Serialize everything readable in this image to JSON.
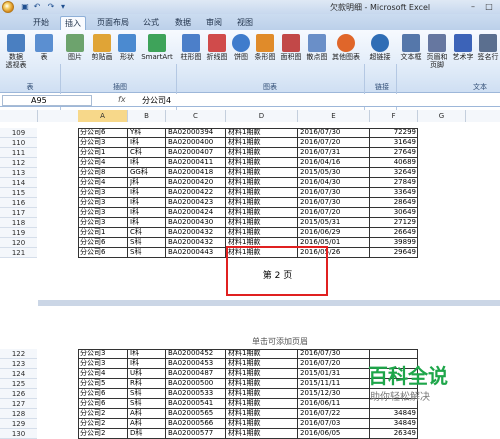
{
  "window": {
    "title": "欠款明细 - Microsoft Excel"
  },
  "tabs": [
    "开始",
    "插入",
    "页面布局",
    "公式",
    "数据",
    "审阅",
    "视图"
  ],
  "ribbon": {
    "items": [
      {
        "label": "数据\n透视表",
        "name": "pivot-table-button",
        "color": "#4a7fc1"
      },
      {
        "label": "表",
        "name": "table-button",
        "color": "#5b8fd1"
      },
      {
        "label": "图片",
        "name": "picture-button",
        "color": "#6da36d"
      },
      {
        "label": "剪贴画",
        "name": "clip-art-button",
        "color": "#e0a436"
      },
      {
        "label": "形状",
        "name": "shapes-button",
        "color": "#4b8ad0"
      },
      {
        "label": "SmartArt",
        "name": "smartart-button",
        "color": "#3ea35a"
      },
      {
        "label": "柱形图",
        "name": "column-chart-button",
        "color": "#4c7fc9"
      },
      {
        "label": "折线图",
        "name": "line-chart-button",
        "color": "#d04b4b"
      },
      {
        "label": "饼图",
        "name": "pie-chart-button",
        "color": "#3f7ccc"
      },
      {
        "label": "条形图",
        "name": "bar-chart-button",
        "color": "#e08b2a"
      },
      {
        "label": "面积图",
        "name": "area-chart-button",
        "color": "#c24848"
      },
      {
        "label": "散点图",
        "name": "scatter-chart-button",
        "color": "#6a8fc8"
      },
      {
        "label": "其他图表",
        "name": "other-charts-button",
        "color": "#e0662a"
      },
      {
        "label": "超链接",
        "name": "hyperlink-button",
        "color": "#2f6db5"
      },
      {
        "label": "文本框",
        "name": "text-box-button",
        "color": "#5577aa"
      },
      {
        "label": "页眉和\n页脚",
        "name": "header-footer-button",
        "color": "#6677a0"
      },
      {
        "label": "艺术字",
        "name": "wordart-button",
        "color": "#3c63b8"
      },
      {
        "label": "签名行",
        "name": "signature-line-button",
        "color": "#5b6f8f"
      }
    ],
    "groups": [
      "表",
      "插图",
      "图表",
      "链接",
      "文本"
    ]
  },
  "formula_bar": {
    "name_box": "A95",
    "fx": "fx",
    "value": "分公司4"
  },
  "columns": [
    "A",
    "B",
    "C",
    "D",
    "E",
    "F",
    "G"
  ],
  "selected_column": "A",
  "page1_rows": [
    {
      "row": "109",
      "a": "分公司6",
      "b": "Y科",
      "c": "BA02000394",
      "d": "材料1期款",
      "e": "2016/07/30",
      "f": "72299"
    },
    {
      "row": "110",
      "a": "分公司3",
      "b": "I科",
      "c": "BA02000400",
      "d": "材料1期款",
      "e": "2016/07/20",
      "f": "31649"
    },
    {
      "row": "111",
      "a": "分公司1",
      "b": "C科",
      "c": "BA02000407",
      "d": "材料1期款",
      "e": "2016/07/31",
      "f": "27649"
    },
    {
      "row": "112",
      "a": "分公司4",
      "b": "I科",
      "c": "BA02000411",
      "d": "材料1期款",
      "e": "2016/04/16",
      "f": "40689"
    },
    {
      "row": "113",
      "a": "分公司8",
      "b": "GG科",
      "c": "BA02000418",
      "d": "材料1期款",
      "e": "2015/05/30",
      "f": "32649"
    },
    {
      "row": "114",
      "a": "分公司4",
      "b": "J科",
      "c": "BA02000420",
      "d": "材料1期款",
      "e": "2016/04/30",
      "f": "27849"
    },
    {
      "row": "115",
      "a": "分公司3",
      "b": "I科",
      "c": "BA02000422",
      "d": "材料1期款",
      "e": "2016/07/30",
      "f": "33649"
    },
    {
      "row": "116",
      "a": "分公司3",
      "b": "I科",
      "c": "BA02000423",
      "d": "材料1期款",
      "e": "2016/07/30",
      "f": "28649"
    },
    {
      "row": "117",
      "a": "分公司3",
      "b": "I科",
      "c": "BA02000424",
      "d": "材料1期款",
      "e": "2016/07/20",
      "f": "30649"
    },
    {
      "row": "118",
      "a": "分公司3",
      "b": "I科",
      "c": "BA02000430",
      "d": "材料1期款",
      "e": "2015/05/31",
      "f": "27129"
    },
    {
      "row": "119",
      "a": "分公司1",
      "b": "C科",
      "c": "BA02000432",
      "d": "材料1期款",
      "e": "2016/06/29",
      "f": "26649"
    },
    {
      "row": "120",
      "a": "分公司6",
      "b": "S科",
      "c": "BA02000432",
      "d": "材料1期款",
      "e": "2016/05/01",
      "f": "39899"
    },
    {
      "row": "121",
      "a": "分公司6",
      "b": "S科",
      "c": "BA02000443",
      "d": "材料1期款",
      "e": "2016/05/26",
      "f": "29649"
    }
  ],
  "page_label": "第 2 页",
  "header_hint": "单击可添加页眉",
  "page2_rows": [
    {
      "row": "122",
      "a": "分公司3",
      "b": "I科",
      "c": "BA02000452",
      "d": "材料1期款",
      "e": "2016/07/30",
      "f": ""
    },
    {
      "row": "123",
      "a": "分公司3",
      "b": "I科",
      "c": "BA02000453",
      "d": "材料1期款",
      "e": "2016/07/20",
      "f": ""
    },
    {
      "row": "124",
      "a": "分公司4",
      "b": "U科",
      "c": "BA02000487",
      "d": "材料1期款",
      "e": "2015/01/31",
      "f": ""
    },
    {
      "row": "125",
      "a": "分公司5",
      "b": "R科",
      "c": "BA02000500",
      "d": "材料1期款",
      "e": "2015/11/11",
      "f": ""
    },
    {
      "row": "126",
      "a": "分公司6",
      "b": "S科",
      "c": "BA02000533",
      "d": "材料1期款",
      "e": "2015/12/30",
      "f": ""
    },
    {
      "row": "127",
      "a": "分公司6",
      "b": "S科",
      "c": "BA02000541",
      "d": "材料1期款",
      "e": "2016/06/11",
      "f": ""
    },
    {
      "row": "128",
      "a": "分公司2",
      "b": "A科",
      "c": "BA02000565",
      "d": "材料1期款",
      "e": "2016/07/22",
      "f": "34849"
    },
    {
      "row": "129",
      "a": "分公司2",
      "b": "A科",
      "c": "BA02000566",
      "d": "材料1期款",
      "e": "2016/07/03",
      "f": "34849"
    },
    {
      "row": "130",
      "a": "分公司2",
      "b": "D科",
      "c": "BA02000577",
      "d": "材料1期款",
      "e": "2016/06/05",
      "f": "26349"
    }
  ],
  "watermark": {
    "main": "百科全说",
    "sub": "助你轻松解决"
  }
}
